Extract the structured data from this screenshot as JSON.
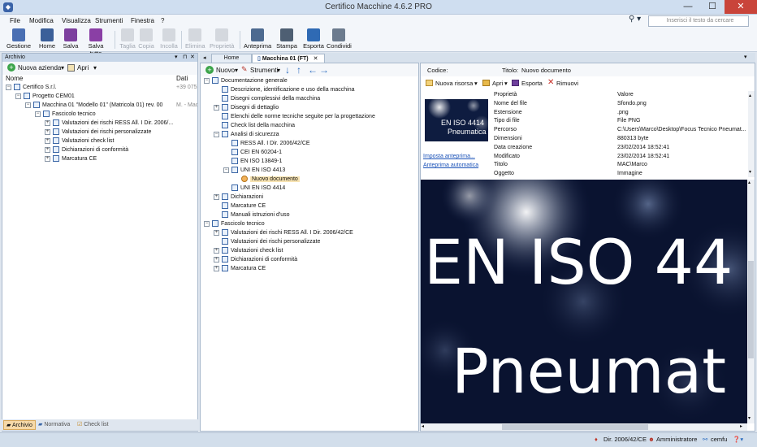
{
  "window": {
    "title": "Certifico Macchine 4.6.2 PRO",
    "minimize": "—",
    "maximize": "☐",
    "close": "✕"
  },
  "menu": [
    "File",
    "Modifica",
    "Visualizza",
    "Strumenti",
    "Finestra",
    "?"
  ],
  "search": {
    "placeholder": "Inserisci il testo da cercare"
  },
  "toolbar": [
    {
      "label": "Gestione",
      "enabled": true,
      "color": "#4a6fb3"
    },
    {
      "label": "Home",
      "enabled": true,
      "color": "#3b5f99"
    },
    {
      "label": "Salva",
      "enabled": true,
      "color": "#7c3f9e"
    },
    {
      "label": "Salva tutto",
      "enabled": true,
      "color": "#8a3fa5"
    },
    {
      "label": "Taglia",
      "enabled": false
    },
    {
      "label": "Copia",
      "enabled": false
    },
    {
      "label": "Incolla",
      "enabled": false
    },
    {
      "label": "Elimina",
      "enabled": false
    },
    {
      "label": "Proprietà",
      "enabled": false
    },
    {
      "label": "Anteprima",
      "enabled": true,
      "color": "#4d6a90"
    },
    {
      "label": "Stampa",
      "enabled": true,
      "color": "#4e5f73"
    },
    {
      "label": "Esporta",
      "enabled": true,
      "color": "#2f6ab4"
    },
    {
      "label": "Condividi",
      "enabled": true,
      "color": "#6c7b8e"
    }
  ],
  "left_panel": {
    "title": "Archivio",
    "new_company": "Nuova azienda",
    "open": "Apri",
    "col_name": "Nome",
    "col_data": "Dati",
    "tree": [
      {
        "label": "Certifico S.r.l.",
        "data": "+39 075",
        "level": 0,
        "expander": "−"
      },
      {
        "label": "Progetto CEM01",
        "data": "",
        "level": 1,
        "expander": "−"
      },
      {
        "label": "Macchina 01 \"Modello 01\" (Matricola 01) rev. 00",
        "data": "M. - Macc",
        "level": 2,
        "expander": "−"
      },
      {
        "label": "Fascicolo tecnico",
        "data": "",
        "level": 3,
        "expander": "−"
      },
      {
        "label": "Valutazioni dei rischi RESS All. I Dir. 2006/...",
        "data": "",
        "level": 4,
        "expander": "+"
      },
      {
        "label": "Valutazioni dei rischi personalizzate",
        "data": "",
        "level": 4,
        "expander": "+"
      },
      {
        "label": "Valutazioni check list",
        "data": "",
        "level": 4,
        "expander": "+"
      },
      {
        "label": "Dichiarazioni di conformità",
        "data": "",
        "level": 4,
        "expander": "+"
      },
      {
        "label": "Marcatura CE",
        "data": "",
        "level": 4,
        "expander": "+"
      }
    ],
    "tabs": [
      "Archivio",
      "Normativa",
      "Check list"
    ]
  },
  "doc_tabs": [
    "Home",
    "Macchina 01 (FT)"
  ],
  "mid_panel": {
    "new": "Nuovo",
    "tools": "Strumenti",
    "tree": [
      {
        "label": "Documentazione generale",
        "level": 0,
        "expander": "−"
      },
      {
        "label": "Descrizione, identificazione e uso della macchina",
        "level": 1,
        "expander": ""
      },
      {
        "label": "Disegni complessivi della macchina",
        "level": 1,
        "expander": ""
      },
      {
        "label": "Disegni di dettaglio",
        "level": 1,
        "expander": "+"
      },
      {
        "label": "Elenchi delle norme tecniche seguite per la progettazione",
        "level": 1,
        "expander": ""
      },
      {
        "label": "Check list della macchina",
        "level": 1,
        "expander": ""
      },
      {
        "label": "Analisi di sicurezza",
        "level": 1,
        "expander": "−"
      },
      {
        "label": "RESS All. I Dir. 2006/42/CE",
        "level": 2,
        "expander": ""
      },
      {
        "label": "CEI EN 60204-1",
        "level": 2,
        "expander": ""
      },
      {
        "label": "EN ISO 13849-1",
        "level": 2,
        "expander": ""
      },
      {
        "label": "UNI EN ISO 4413",
        "level": 2,
        "expander": "−"
      },
      {
        "label": "Nuovo documento",
        "level": 3,
        "expander": "",
        "selected": true
      },
      {
        "label": "UNI EN ISO 4414",
        "level": 2,
        "expander": ""
      },
      {
        "label": "Dichiarazioni",
        "level": 1,
        "expander": "+"
      },
      {
        "label": "Marcature CE",
        "level": 1,
        "expander": ""
      },
      {
        "label": "Manuali istruzioni d'uso",
        "level": 1,
        "expander": ""
      },
      {
        "label": "Fascicolo tecnico",
        "level": 0,
        "expander": "−"
      },
      {
        "label": "Valutazioni dei rischi RESS All. I Dir. 2006/42/CE",
        "level": 1,
        "expander": "+"
      },
      {
        "label": "Valutazioni dei rischi personalizzate",
        "level": 1,
        "expander": ""
      },
      {
        "label": "Valutazioni check list",
        "level": 1,
        "expander": "+"
      },
      {
        "label": "Dichiarazioni di conformità",
        "level": 1,
        "expander": "+"
      },
      {
        "label": "Marcatura CE",
        "level": 1,
        "expander": "+"
      }
    ]
  },
  "right_panel": {
    "code_label": "Codice:",
    "code_value": "",
    "title_label": "Titolo:",
    "title_value": "Nuovo documento",
    "new_resource": "Nuova risorsa",
    "open": "Apri",
    "export": "Esporta",
    "remove": "Rimuovi",
    "set_preview": "Imposta anteprima...",
    "auto_preview": "Anteprima automatica",
    "thumb_line1": "EN ISO 4414",
    "thumb_line2": "Pneumatica",
    "prop_header": "Proprietà",
    "value_header": "Valore",
    "properties": [
      {
        "key": "Nome del file",
        "value": "Sfondo.png"
      },
      {
        "key": "Estensione",
        "value": ".png"
      },
      {
        "key": "Tipo di file",
        "value": "File PNG"
      },
      {
        "key": "Percorso",
        "value": "C:\\Users\\Marco\\Desktop\\Focus Tecnico Pneumat..."
      },
      {
        "key": "Dimensioni",
        "value": "880313 byte"
      },
      {
        "key": "Data creazione",
        "value": "23/02/2014 18:52:41"
      },
      {
        "key": "Modificato",
        "value": "23/02/2014 18:52:41"
      },
      {
        "key": "Titolo",
        "value": "MAC\\Marco"
      },
      {
        "key": "Oggetto",
        "value": "Immagine"
      }
    ],
    "preview_line1": "EN ISO 44",
    "preview_line2": "Pneumat"
  },
  "status": {
    "directive": "Dir. 2006/42/CE",
    "role": "Amministratore",
    "user": "cemfu"
  }
}
